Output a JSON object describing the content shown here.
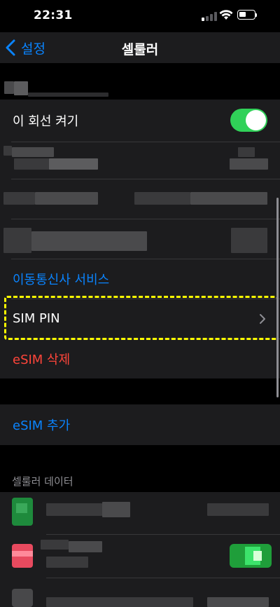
{
  "status": {
    "time": "22:31"
  },
  "nav": {
    "back_label": "설정",
    "title": "셀룰러"
  },
  "rows": {
    "line_toggle": {
      "label": "이 회선 켜기",
      "on": true
    },
    "carrier_services": "이동통신사 서비스",
    "sim_pin": "SIM PIN",
    "delete_esim": "eSIM 삭제",
    "add_esim": "eSIM 추가"
  },
  "sections": {
    "cellular_data": "셀룰러 데이터"
  },
  "colors": {
    "accent": "#0a84ff",
    "destructive": "#ff453a",
    "toggle_on": "#30d158",
    "highlight": "#ffff00"
  }
}
